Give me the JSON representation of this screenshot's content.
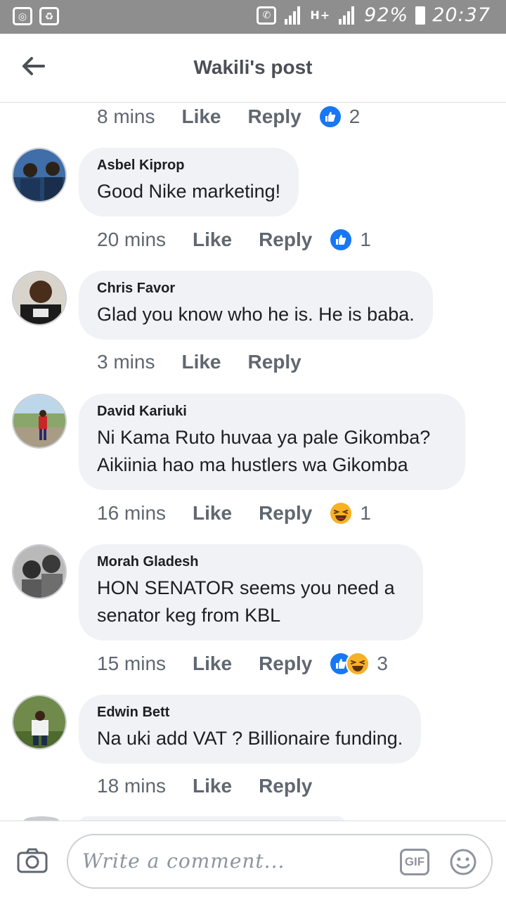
{
  "status_bar": {
    "battery": "92%",
    "time": "20:37",
    "network": "H+"
  },
  "header": {
    "title": "Wakili's post",
    "back_icon": "arrow-left-icon"
  },
  "comments": [
    {
      "partial": true,
      "time": "8 mins",
      "like_label": "Like",
      "reply_label": "Reply",
      "reactions": [
        "like"
      ],
      "reaction_count": "2"
    },
    {
      "name": "Asbel Kiprop",
      "text": "Good Nike marketing!",
      "time": "20 mins",
      "like_label": "Like",
      "reply_label": "Reply",
      "reactions": [
        "like"
      ],
      "reaction_count": "1"
    },
    {
      "name": "Chris Favor",
      "text": "Glad you know who he is. He is baba.",
      "time": "3 mins",
      "like_label": "Like",
      "reply_label": "Reply",
      "reactions": [],
      "reaction_count": ""
    },
    {
      "name": "David Kariuki",
      "text": "Ni Kama Ruto huvaa ya pale Gikomba? Aikiinia hao ma hustlers wa Gikomba",
      "time": "16 mins",
      "like_label": "Like",
      "reply_label": "Reply",
      "reactions": [
        "haha"
      ],
      "reaction_count": "1"
    },
    {
      "name": "Morah Gladesh",
      "text": "HON SENATOR seems you need a senator keg from KBL",
      "time": "15 mins",
      "like_label": "Like",
      "reply_label": "Reply",
      "reactions": [
        "like",
        "haha"
      ],
      "reaction_count": "3"
    },
    {
      "name": "Edwin Bett",
      "text": "Na uki add VAT ? Billionaire funding.",
      "time": "18 mins",
      "like_label": "Like",
      "reply_label": "Reply",
      "reactions": [],
      "reaction_count": ""
    }
  ],
  "composer": {
    "placeholder": "Write a comment...",
    "gif_label": "GIF",
    "camera_icon": "camera-icon",
    "emoji_icon": "smiley-icon"
  },
  "colors": {
    "like_blue": "#1877f2",
    "haha_yellow": "#f7b125",
    "bubble_bg": "#f0f2f5",
    "status_bar": "#8e8e8e"
  }
}
